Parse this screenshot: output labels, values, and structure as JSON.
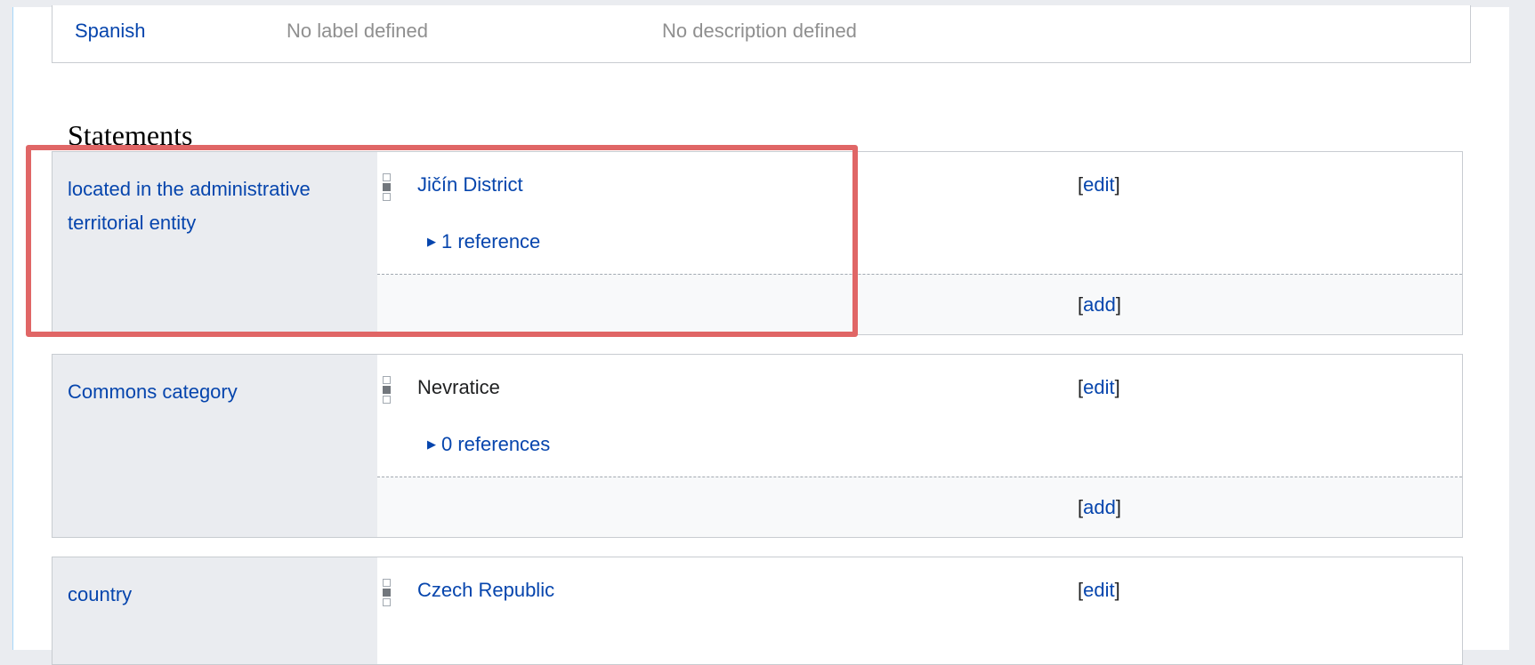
{
  "terms": {
    "language": "Spanish",
    "label": "No label defined",
    "description": "No description defined"
  },
  "statements_heading": "Statements",
  "statements": [
    {
      "property": "located in the administrative territorial entity",
      "value": "Jičín District",
      "value_is_link": true,
      "references": "1 reference",
      "edit_label": "edit",
      "add_label": "add"
    },
    {
      "property": "Commons category",
      "value": "Nevratice",
      "value_is_link": false,
      "references": "0 references",
      "edit_label": "edit",
      "add_label": "add"
    },
    {
      "property": "country",
      "value": "Czech Republic",
      "value_is_link": true,
      "edit_label": "edit"
    }
  ],
  "highlight": {
    "color": "#e06666"
  },
  "colors": {
    "link": "#0645ad",
    "muted": "#8f8f8f",
    "property_bg": "#eaecf0"
  }
}
